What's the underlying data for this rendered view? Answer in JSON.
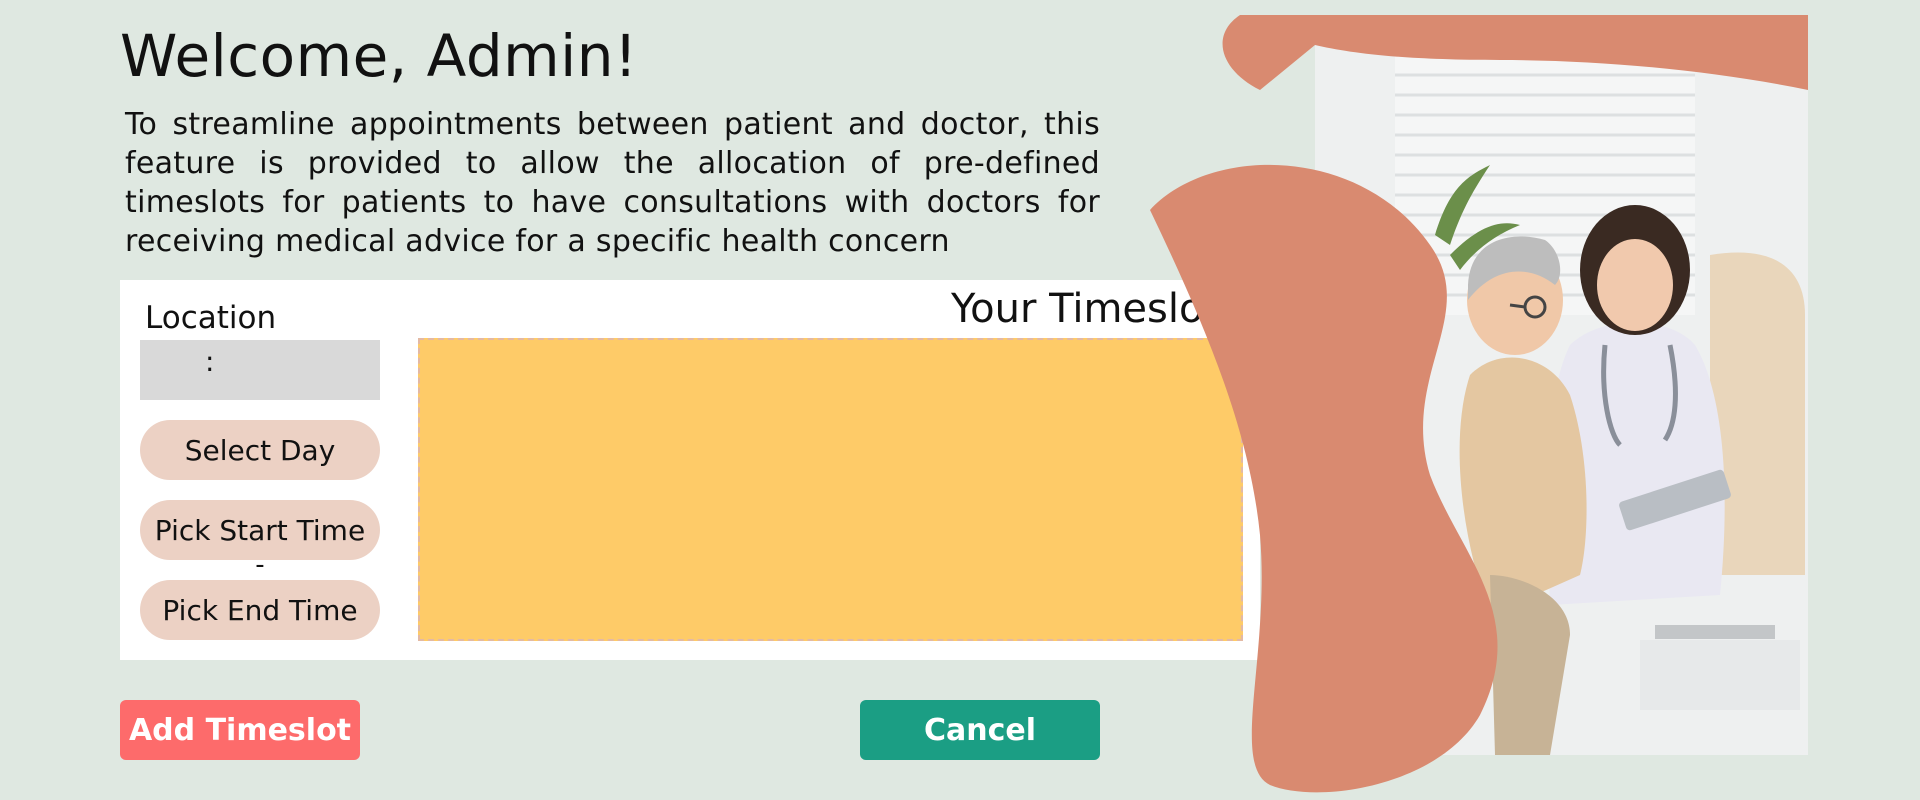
{
  "header": {
    "title": "Welcome, Admin!",
    "description": "To streamline appointments between patient and doctor, this feature is provided to allow the allocation of pre-defined timeslots for patients to have consultations with doctors for receiving medical advice for a specific health concern"
  },
  "form": {
    "location_label": "Location",
    "location_value": ":",
    "select_day_label": "Select Day",
    "pick_start_label": "Pick Start Time",
    "separator": "-",
    "pick_end_label": "Pick End Time"
  },
  "timeslots": {
    "title": "Your Timeslots"
  },
  "actions": {
    "add_label": "Add Timeslot",
    "cancel_label": "Cancel"
  },
  "colors": {
    "background": "#dfe8e1",
    "accent_shape": "#d98a70",
    "timeslot_area": "#fecb68",
    "pill": "#ecd1c4",
    "add_button": "#fd6b6b",
    "cancel_button": "#1b9e84"
  },
  "illustration": {
    "icon": "doctor-patient-photo"
  }
}
